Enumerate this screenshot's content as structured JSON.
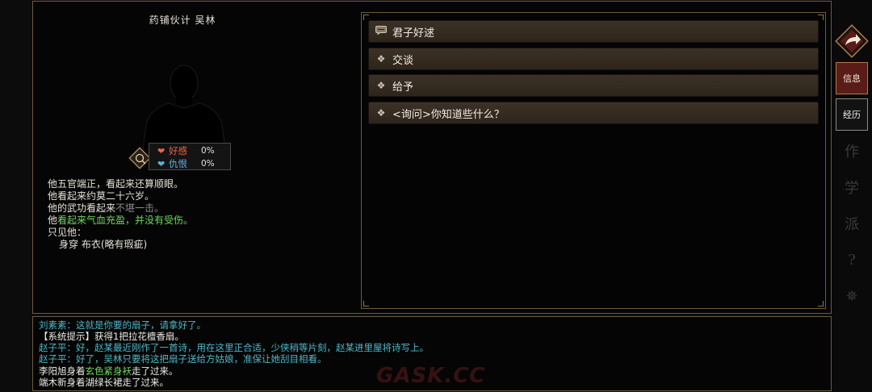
{
  "npc": {
    "title": "药铺伙计 吴林",
    "stats": {
      "favor_label": "好感",
      "favor_value": "0%",
      "hatred_label": "仇恨",
      "hatred_value": "0%"
    },
    "description": {
      "line1": "他五官端正，看起来还算顺眼。",
      "line2": "他看起来约莫二十六岁。",
      "line3_prefix": "他的武功看起来",
      "line3_status": "不堪一击。",
      "line4_prefix": "他",
      "line4_status": "看起来气血充盈，并没有受伤。",
      "line5": "只见他：",
      "line6": "身穿 布衣(略有瑕疵)"
    }
  },
  "options": [
    {
      "label": "君子好逑",
      "icon": "chat-bubble-icon"
    },
    {
      "label": "交谈",
      "icon": "diamond-icon"
    },
    {
      "label": "给予",
      "icon": "diamond-icon"
    },
    {
      "label": "<询问>你知道些什么？",
      "icon": "diamond-icon"
    }
  ],
  "sidebar": {
    "info_label": "信息",
    "experience_label": "经历",
    "faded": [
      "作",
      "学",
      "派",
      "?",
      "✵"
    ]
  },
  "log": {
    "line1": "刘素素：这就是你要的扇子，请拿好了。",
    "line2": "【系统提示】获得1把拉花檀香扇。",
    "line3": "赵子平：好，赵某最近刚作了一首诗，用在这里正合适，少侠稍等片刻，赵某进里屋将诗写上。",
    "line4": "赵子平：好了，吴林只要将这把扇子送给方姑娘，准保让她刮目相看。",
    "line5_prefix": "李阳旭身着",
    "line5_item": "玄色紧身袄",
    "line5_suffix": "走了过来。",
    "line6": "端木新身着湖绿长裙走了过来。"
  },
  "watermark": "GASK.CC",
  "colors": {
    "accent_gold": "#6d5a3e",
    "option_bg": "#3c3126",
    "log_cyan": "#4fb8c8",
    "status_green": "#6fd85e",
    "heart_red": "#e8634a",
    "heart_blue": "#5ab4e0",
    "active_tab": "#5a1c18"
  }
}
